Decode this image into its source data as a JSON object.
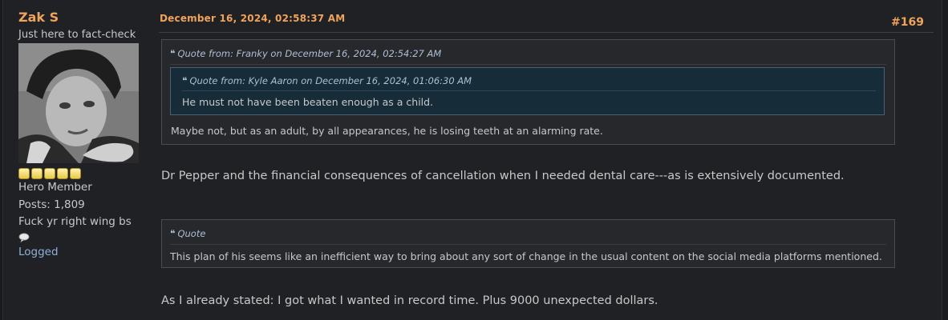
{
  "poster": {
    "name": "Zak S",
    "title": "Just here to fact-check",
    "rank": "Hero Member",
    "posts": "Posts: 1,809",
    "personal_text": "Fuck yr right wing bs",
    "stars": 5,
    "logged": "Logged"
  },
  "post": {
    "date": "December 16, 2024, 02:58:37 AM",
    "counter": "#169",
    "quote1": {
      "header": "Quote from: Franky on December 16, 2024, 02:54:27 AM",
      "nested": {
        "header": "Quote from: Kyle Aaron on December 16, 2024, 01:06:30 AM",
        "text": "He must not have been beaten enough as a child."
      },
      "text": "Maybe not, but as an adult, by all appearances, he is losing teeth at an alarming rate."
    },
    "reply1": "Dr Pepper and the financial consequences of cancellation when I needed dental care---as is extensively documented.",
    "quote2": {
      "header": "Quote",
      "text": "This plan of his seems like an inefficient way to bring about any sort of change in the usual content on the social media platforms mentioned."
    },
    "reply2": "As I already stated: I got what I wanted in record time. Plus 9000 unexpected dollars."
  },
  "colors": {
    "accent": "#f0a35a",
    "link": "#8fb1d8",
    "quote_header": "#aebfd6",
    "nested_quote_bg": "#162c38"
  },
  "icons": {
    "quote": "quote-icon",
    "speech_bubble": "speech-bubble-icon",
    "star": "star-icon"
  }
}
